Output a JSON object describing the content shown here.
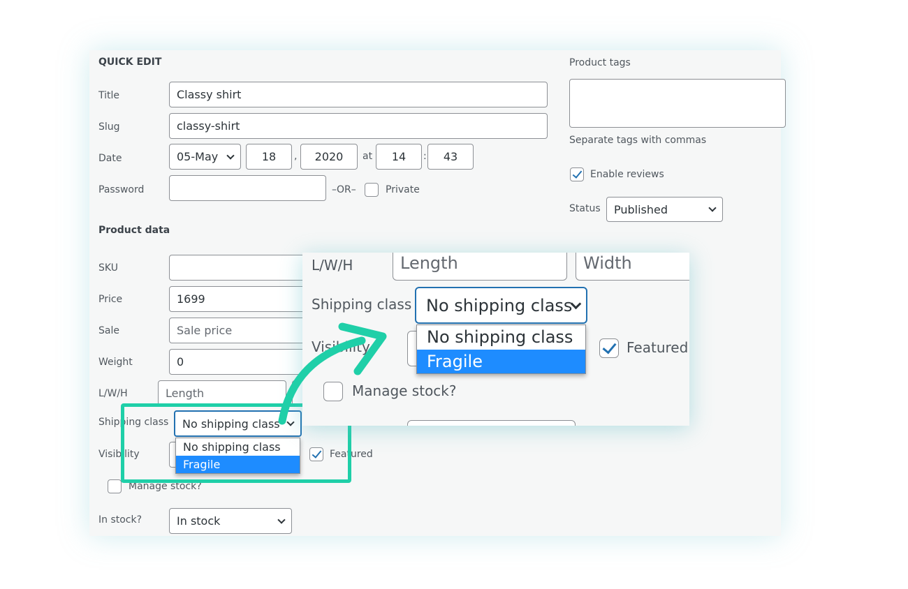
{
  "quick_edit": {
    "heading": "QUICK EDIT",
    "title": {
      "label": "Title",
      "value": "Classy shirt"
    },
    "slug": {
      "label": "Slug",
      "value": "classy-shirt"
    },
    "date": {
      "label": "Date",
      "month": "05-May",
      "day": "18",
      "sep1": ",",
      "year": "2020",
      "at": "at",
      "hour": "14",
      "sep2": ":",
      "minute": "43"
    },
    "password": {
      "label": "Password",
      "value": "",
      "or": "–OR–",
      "private_label": "Private",
      "private_checked": false
    }
  },
  "right": {
    "tags_label": "Product tags",
    "tags_value": "",
    "tags_hint": "Separate tags with commas",
    "enable_reviews": "Enable reviews",
    "enable_reviews_checked": true,
    "status_label": "Status",
    "status_value": "Published"
  },
  "product_data": {
    "heading": "Product data",
    "sku": {
      "label": "SKU",
      "value": ""
    },
    "price": {
      "label": "Price",
      "value": "1699"
    },
    "sale": {
      "label": "Sale",
      "placeholder": "Sale price"
    },
    "weight": {
      "label": "Weight",
      "value": "0"
    },
    "lwh": {
      "label": "L/W/H",
      "length_placeholder": "Length",
      "width_placeholder": "Width"
    },
    "shipping": {
      "label": "Shipping class",
      "value": "No shipping class",
      "options": [
        "No shipping class",
        "Fragile"
      ],
      "highlighted": "Fragile"
    },
    "visibility": {
      "label": "Visibility"
    },
    "featured": {
      "label": "Featured",
      "checked": true
    },
    "manage_stock": {
      "label": "Manage stock?",
      "checked": false
    },
    "in_stock": {
      "label": "In stock?",
      "value": "In stock"
    }
  },
  "colors": {
    "accent": "#1fcfa8",
    "highlight": "#1e8cff",
    "focus": "#2271b1"
  }
}
